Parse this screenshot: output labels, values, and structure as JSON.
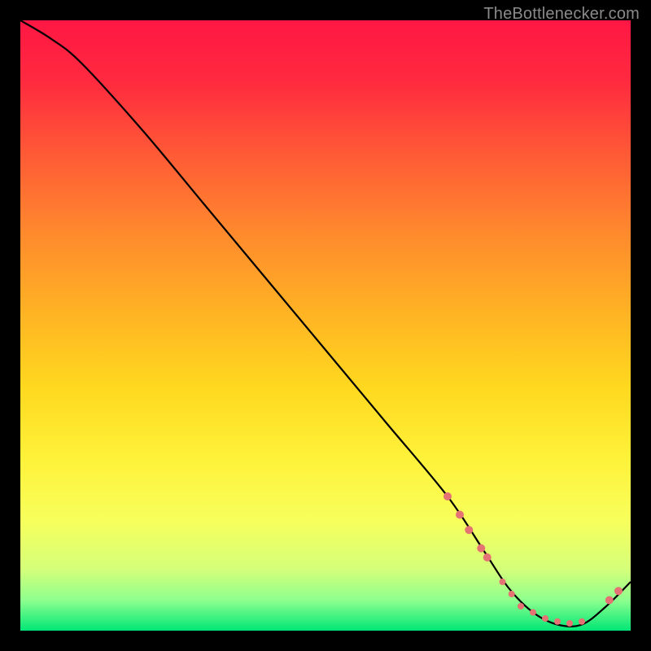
{
  "watermark": "TheBottlenecker.com",
  "colors": {
    "frame_bg_color": "#000000",
    "line_color": "#000000",
    "marker_color": "#e57373",
    "gradient_stops": [
      {
        "offset": 0.0,
        "color": "#ff1744"
      },
      {
        "offset": 0.1,
        "color": "#ff2a3f"
      },
      {
        "offset": 0.22,
        "color": "#ff5a36"
      },
      {
        "offset": 0.35,
        "color": "#ff8a2d"
      },
      {
        "offset": 0.48,
        "color": "#ffb324"
      },
      {
        "offset": 0.6,
        "color": "#ffd81f"
      },
      {
        "offset": 0.72,
        "color": "#fff23a"
      },
      {
        "offset": 0.82,
        "color": "#f7ff5c"
      },
      {
        "offset": 0.9,
        "color": "#d4ff7a"
      },
      {
        "offset": 0.95,
        "color": "#8eff8e"
      },
      {
        "offset": 1.0,
        "color": "#00e676"
      }
    ]
  },
  "chart_data": {
    "type": "line",
    "title": "",
    "xlabel": "",
    "ylabel": "",
    "xlim": [
      0,
      100
    ],
    "ylim": [
      0,
      100
    ],
    "series": [
      {
        "name": "curve",
        "x": [
          0,
          5,
          10,
          20,
          30,
          40,
          50,
          60,
          70,
          76,
          80,
          84,
          88,
          92,
          96,
          100
        ],
        "values": [
          100,
          97,
          93,
          82,
          70,
          58,
          46,
          34,
          22,
          13,
          7,
          3,
          1,
          1,
          4,
          8
        ]
      }
    ],
    "markers": [
      {
        "x": 70.0,
        "y": 22.0,
        "r": 5
      },
      {
        "x": 72.0,
        "y": 19.0,
        "r": 5
      },
      {
        "x": 73.5,
        "y": 16.5,
        "r": 5
      },
      {
        "x": 75.5,
        "y": 13.5,
        "r": 5
      },
      {
        "x": 76.5,
        "y": 12.0,
        "r": 5
      },
      {
        "x": 79.0,
        "y": 8.0,
        "r": 4
      },
      {
        "x": 80.5,
        "y": 6.0,
        "r": 4
      },
      {
        "x": 82.0,
        "y": 4.0,
        "r": 4
      },
      {
        "x": 84.0,
        "y": 3.0,
        "r": 4
      },
      {
        "x": 86.0,
        "y": 2.0,
        "r": 4
      },
      {
        "x": 88.0,
        "y": 1.5,
        "r": 4
      },
      {
        "x": 90.0,
        "y": 1.2,
        "r": 4
      },
      {
        "x": 92.0,
        "y": 1.5,
        "r": 4
      },
      {
        "x": 96.5,
        "y": 5.0,
        "r": 5
      },
      {
        "x": 98.0,
        "y": 6.5,
        "r": 5
      }
    ]
  }
}
